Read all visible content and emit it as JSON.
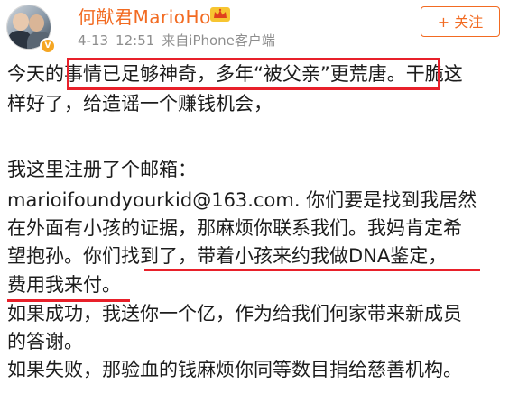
{
  "header": {
    "username": "何猷君MarioHo",
    "date": "4-13",
    "time": "12:51",
    "source": "来自iPhone客户端",
    "follow_label": "+ 关注",
    "verified_badge_icon": "verified-v-icon",
    "crown_icon": "crown-icon"
  },
  "post": {
    "line1_prefix": "今天的",
    "line1_highlight": "事情已足够神奇，多年“被父亲”更荒唐。",
    "line1_suffix": "干脆这",
    "line2": "样好了，给造谣一个赚钱机会，",
    "line3": "我这里注册了个邮箱：",
    "line4": "marioifoundyourkid@163.com. 你们要是找到我居然",
    "line5": "在外面有小孩的证据，那麻烦你联系我们。我妈肯定希",
    "line6": "望抱孙。你们找到了，带着小孩来约我做DNA鉴定，",
    "line7": "费用我来付。",
    "line8": "如果成功，我送你一个亿，作为给我们何家带来新成员",
    "line9": "的答谢。",
    "line10": "如果失败，那验血的钱麻烦你同等数目捐给慈善机构。"
  },
  "colors": {
    "username": "#f26b22",
    "follow_border": "#f26b22",
    "highlight": "#e8202a",
    "meta_text": "#8e8e8e",
    "body_text": "#1c1c1c"
  }
}
